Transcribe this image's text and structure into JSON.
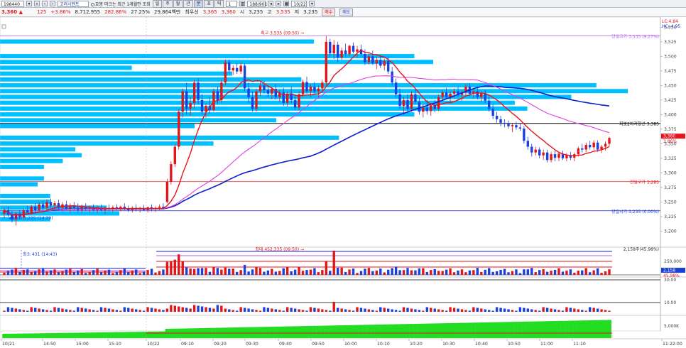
{
  "toolbar": {
    "code": "198440",
    "name": "고려시멘트",
    "radio_label": "호봉 마크는 최근 1개월만 조회",
    "period_buttons": [
      "일",
      "주",
      "월",
      "년",
      "분",
      "초",
      "틱"
    ],
    "interval_value": "1",
    "count": "188/901",
    "date": "10/22"
  },
  "quote": {
    "price": "3,360",
    "change": "125",
    "change_pct": "+3.86%",
    "volume": "8,712,955",
    "volume_ratio": "282.86%",
    "turnover_ratio": "27.25%",
    "amount": "29,864백만",
    "best_ask_label": "최우선",
    "best_ask": "3,365",
    "best_bid": "3,360",
    "open_label": "시",
    "open": "3,235",
    "high_label": "고",
    "high": "3,535",
    "low_label": "저",
    "low": "3,235",
    "buy_label": "매수",
    "sell_label": "매도"
  },
  "labels": {
    "lc": "LC:4.84",
    "hc": "HC:-4.95",
    "high_marker": "최고 3,535 (09:50)",
    "low_marker": "최저가 3,235 (14:39)",
    "day_high": "당일고가 3,535 (9.27%)",
    "support": "피봇2차저항선 3,385",
    "prev_high": "전일고가 3,285",
    "day_open": "당일시가 3,235 (0.00%)",
    "price_tag": "3,360",
    "pct_tag": "3.86%",
    "vol_max": "최대 452,335 (09:50)",
    "vol_min": "최소 431 (14:43)",
    "vol_pct": "2,158주(45.98%)",
    "vol_tag": "2,158",
    "vol_pct_tag": "45.98%"
  },
  "colors": {
    "up": "#e0161b",
    "down": "#1c3fe0",
    "ma_short": "#e8141c",
    "ma_mid": "#e040e0",
    "ma_long": "#0b1fd0",
    "profile": "#00bfff",
    "cum_volume": "#22dd22"
  },
  "chart_data": {
    "type": "candlestick",
    "ylim": [
      3175,
      3565
    ],
    "price_ticks": [
      "3,550",
      "3,525",
      "3,500",
      "3,475",
      "3,450",
      "3,425",
      "3,400",
      "3,375",
      "3,350",
      "3,325",
      "3,300",
      "3,275",
      "3,250",
      "3,225",
      "3,200"
    ],
    "time_ticks": [
      "10/21",
      "14:50",
      "15:00",
      "15:10",
      "10/22",
      "09:10",
      "09:20",
      "09:30",
      "09:40",
      "09:50",
      "10:00",
      "10:10",
      "10:20",
      "10:30",
      "10:40",
      "10:50",
      "11:00",
      "11:10",
      "11:22:00"
    ],
    "reference_lines": {
      "day_high": 3535,
      "support": 3385,
      "prev_high": 3285,
      "day_open": 3235
    },
    "volume_ticks": [
      "250,000",
      "0"
    ],
    "osc_ticks": [
      "30.00",
      "10.00"
    ],
    "cum_ticks": [
      "5,000K"
    ],
    "volume_profile": [
      {
        "price": 3525,
        "width": 0.5
      },
      {
        "price": 3500,
        "width": 0.66
      },
      {
        "price": 3490,
        "width": 0.69
      },
      {
        "price": 3480,
        "width": 0.21
      },
      {
        "price": 3470,
        "width": 0.37
      },
      {
        "price": 3460,
        "width": 0.48
      },
      {
        "price": 3450,
        "width": 0.95
      },
      {
        "price": 3440,
        "width": 1.0
      },
      {
        "price": 3430,
        "width": 0.91
      },
      {
        "price": 3420,
        "width": 0.82
      },
      {
        "price": 3410,
        "width": 0.84
      },
      {
        "price": 3400,
        "width": 0.66
      },
      {
        "price": 3390,
        "width": 0.44
      },
      {
        "price": 3380,
        "width": 0.31
      },
      {
        "price": 3360,
        "width": 0.54
      },
      {
        "price": 3350,
        "width": 0.34
      },
      {
        "price": 3340,
        "width": 0.12
      },
      {
        "price": 3330,
        "width": 0.13
      },
      {
        "price": 3320,
        "width": 0.1
      },
      {
        "price": 3310,
        "width": 0.07
      },
      {
        "price": 3290,
        "width": 0.07
      },
      {
        "price": 3280,
        "width": 0.06
      },
      {
        "price": 3260,
        "width": 0.08
      },
      {
        "price": 3250,
        "width": 0.08
      },
      {
        "price": 3240,
        "width": 0.17
      },
      {
        "price": 3230,
        "width": 0.19
      },
      {
        "price": 3220,
        "width": 0.08
      }
    ],
    "candles": [
      {
        "o": 3230,
        "h": 3240,
        "l": 3222,
        "c": 3236
      },
      {
        "o": 3236,
        "h": 3242,
        "l": 3225,
        "c": 3228
      },
      {
        "o": 3228,
        "h": 3235,
        "l": 3215,
        "c": 3220
      },
      {
        "o": 3220,
        "h": 3232,
        "l": 3210,
        "c": 3230
      },
      {
        "o": 3230,
        "h": 3236,
        "l": 3220,
        "c": 3224
      },
      {
        "o": 3224,
        "h": 3238,
        "l": 3220,
        "c": 3236
      },
      {
        "o": 3236,
        "h": 3244,
        "l": 3228,
        "c": 3232
      },
      {
        "o": 3232,
        "h": 3245,
        "l": 3228,
        "c": 3242
      },
      {
        "o": 3242,
        "h": 3248,
        "l": 3232,
        "c": 3236
      },
      {
        "o": 3236,
        "h": 3250,
        "l": 3232,
        "c": 3246
      },
      {
        "o": 3246,
        "h": 3252,
        "l": 3236,
        "c": 3240
      },
      {
        "o": 3240,
        "h": 3255,
        "l": 3236,
        "c": 3250
      },
      {
        "o": 3250,
        "h": 3256,
        "l": 3240,
        "c": 3244
      },
      {
        "o": 3244,
        "h": 3252,
        "l": 3238,
        "c": 3248
      },
      {
        "o": 3248,
        "h": 3254,
        "l": 3236,
        "c": 3240
      },
      {
        "o": 3240,
        "h": 3250,
        "l": 3234,
        "c": 3246
      },
      {
        "o": 3246,
        "h": 3252,
        "l": 3236,
        "c": 3238
      },
      {
        "o": 3238,
        "h": 3248,
        "l": 3232,
        "c": 3244
      },
      {
        "o": 3244,
        "h": 3250,
        "l": 3236,
        "c": 3240
      },
      {
        "o": 3240,
        "h": 3248,
        "l": 3232,
        "c": 3236
      },
      {
        "o": 3236,
        "h": 3246,
        "l": 3232,
        "c": 3242
      },
      {
        "o": 3242,
        "h": 3248,
        "l": 3235,
        "c": 3238
      },
      {
        "o": 3238,
        "h": 3244,
        "l": 3232,
        "c": 3240
      },
      {
        "o": 3240,
        "h": 3246,
        "l": 3234,
        "c": 3236
      },
      {
        "o": 3236,
        "h": 3244,
        "l": 3232,
        "c": 3240
      },
      {
        "o": 3240,
        "h": 3246,
        "l": 3234,
        "c": 3236
      },
      {
        "o": 3236,
        "h": 3242,
        "l": 3230,
        "c": 3240
      },
      {
        "o": 3240,
        "h": 3246,
        "l": 3234,
        "c": 3238
      },
      {
        "o": 3238,
        "h": 3244,
        "l": 3233,
        "c": 3241
      },
      {
        "o": 3241,
        "h": 3246,
        "l": 3236,
        "c": 3238
      },
      {
        "o": 3238,
        "h": 3244,
        "l": 3234,
        "c": 3242
      },
      {
        "o": 3242,
        "h": 3248,
        "l": 3236,
        "c": 3239
      },
      {
        "o": 3239,
        "h": 3244,
        "l": 3233,
        "c": 3236
      },
      {
        "o": 3236,
        "h": 3243,
        "l": 3232,
        "c": 3240
      },
      {
        "o": 3240,
        "h": 3246,
        "l": 3234,
        "c": 3237
      },
      {
        "o": 3237,
        "h": 3242,
        "l": 3232,
        "c": 3240
      },
      {
        "o": 3240,
        "h": 3245,
        "l": 3235,
        "c": 3236
      },
      {
        "o": 3236,
        "h": 3242,
        "l": 3232,
        "c": 3241
      },
      {
        "o": 3241,
        "h": 3246,
        "l": 3234,
        "c": 3238
      },
      {
        "o": 3238,
        "h": 3243,
        "l": 3233,
        "c": 3240
      },
      {
        "o": 3240,
        "h": 3246,
        "l": 3236,
        "c": 3242
      },
      {
        "o": 3242,
        "h": 3248,
        "l": 3237,
        "c": 3239
      },
      {
        "o": 3250,
        "h": 3290,
        "l": 3248,
        "c": 3285
      },
      {
        "o": 3285,
        "h": 3320,
        "l": 3280,
        "c": 3315
      },
      {
        "o": 3315,
        "h": 3350,
        "l": 3310,
        "c": 3345
      },
      {
        "o": 3345,
        "h": 3410,
        "l": 3340,
        "c": 3405
      },
      {
        "o": 3405,
        "h": 3445,
        "l": 3395,
        "c": 3440
      },
      {
        "o": 3440,
        "h": 3455,
        "l": 3400,
        "c": 3410
      },
      {
        "o": 3410,
        "h": 3430,
        "l": 3398,
        "c": 3420
      },
      {
        "o": 3420,
        "h": 3460,
        "l": 3410,
        "c": 3455
      },
      {
        "o": 3455,
        "h": 3462,
        "l": 3418,
        "c": 3425
      },
      {
        "o": 3425,
        "h": 3435,
        "l": 3400,
        "c": 3405
      },
      {
        "o": 3405,
        "h": 3420,
        "l": 3395,
        "c": 3415
      },
      {
        "o": 3415,
        "h": 3430,
        "l": 3402,
        "c": 3408
      },
      {
        "o": 3408,
        "h": 3445,
        "l": 3405,
        "c": 3440
      },
      {
        "o": 3440,
        "h": 3448,
        "l": 3418,
        "c": 3425
      },
      {
        "o": 3425,
        "h": 3460,
        "l": 3420,
        "c": 3455
      },
      {
        "o": 3455,
        "h": 3495,
        "l": 3450,
        "c": 3490
      },
      {
        "o": 3490,
        "h": 3495,
        "l": 3470,
        "c": 3476
      },
      {
        "o": 3476,
        "h": 3485,
        "l": 3468,
        "c": 3480
      },
      {
        "o": 3480,
        "h": 3488,
        "l": 3470,
        "c": 3474
      },
      {
        "o": 3474,
        "h": 3490,
        "l": 3470,
        "c": 3484
      },
      {
        "o": 3484,
        "h": 3488,
        "l": 3440,
        "c": 3445
      },
      {
        "o": 3445,
        "h": 3455,
        "l": 3420,
        "c": 3430
      },
      {
        "o": 3430,
        "h": 3440,
        "l": 3405,
        "c": 3410
      },
      {
        "o": 3410,
        "h": 3445,
        "l": 3405,
        "c": 3440
      },
      {
        "o": 3440,
        "h": 3456,
        "l": 3432,
        "c": 3450
      },
      {
        "o": 3450,
        "h": 3458,
        "l": 3436,
        "c": 3442
      },
      {
        "o": 3442,
        "h": 3450,
        "l": 3430,
        "c": 3436
      },
      {
        "o": 3436,
        "h": 3448,
        "l": 3426,
        "c": 3444
      },
      {
        "o": 3444,
        "h": 3452,
        "l": 3426,
        "c": 3430
      },
      {
        "o": 3430,
        "h": 3442,
        "l": 3422,
        "c": 3438
      },
      {
        "o": 3438,
        "h": 3446,
        "l": 3415,
        "c": 3420
      },
      {
        "o": 3420,
        "h": 3440,
        "l": 3414,
        "c": 3436
      },
      {
        "o": 3436,
        "h": 3448,
        "l": 3420,
        "c": 3425
      },
      {
        "o": 3425,
        "h": 3435,
        "l": 3408,
        "c": 3412
      },
      {
        "o": 3412,
        "h": 3440,
        "l": 3408,
        "c": 3435
      },
      {
        "o": 3435,
        "h": 3460,
        "l": 3430,
        "c": 3456
      },
      {
        "o": 3456,
        "h": 3465,
        "l": 3436,
        "c": 3440
      },
      {
        "o": 3440,
        "h": 3452,
        "l": 3430,
        "c": 3448
      },
      {
        "o": 3448,
        "h": 3456,
        "l": 3435,
        "c": 3440
      },
      {
        "o": 3440,
        "h": 3450,
        "l": 3428,
        "c": 3445
      },
      {
        "o": 3445,
        "h": 3460,
        "l": 3440,
        "c": 3455
      },
      {
        "o": 3455,
        "h": 3535,
        "l": 3450,
        "c": 3525
      },
      {
        "o": 3525,
        "h": 3530,
        "l": 3500,
        "c": 3505
      },
      {
        "o": 3505,
        "h": 3528,
        "l": 3495,
        "c": 3520
      },
      {
        "o": 3520,
        "h": 3525,
        "l": 3490,
        "c": 3498
      },
      {
        "o": 3498,
        "h": 3515,
        "l": 3494,
        "c": 3510
      },
      {
        "o": 3510,
        "h": 3522,
        "l": 3500,
        "c": 3504
      },
      {
        "o": 3504,
        "h": 3520,
        "l": 3500,
        "c": 3518
      },
      {
        "o": 3518,
        "h": 3524,
        "l": 3505,
        "c": 3508
      },
      {
        "o": 3508,
        "h": 3518,
        "l": 3498,
        "c": 3512
      },
      {
        "o": 3512,
        "h": 3520,
        "l": 3500,
        "c": 3504
      },
      {
        "o": 3504,
        "h": 3512,
        "l": 3485,
        "c": 3490
      },
      {
        "o": 3490,
        "h": 3505,
        "l": 3486,
        "c": 3500
      },
      {
        "o": 3500,
        "h": 3510,
        "l": 3485,
        "c": 3488
      },
      {
        "o": 3488,
        "h": 3500,
        "l": 3478,
        "c": 3494
      },
      {
        "o": 3494,
        "h": 3502,
        "l": 3480,
        "c": 3484
      },
      {
        "o": 3484,
        "h": 3496,
        "l": 3476,
        "c": 3492
      },
      {
        "o": 3492,
        "h": 3500,
        "l": 3470,
        "c": 3474
      },
      {
        "o": 3474,
        "h": 3482,
        "l": 3450,
        "c": 3455
      },
      {
        "o": 3455,
        "h": 3462,
        "l": 3430,
        "c": 3435
      },
      {
        "o": 3435,
        "h": 3445,
        "l": 3410,
        "c": 3415
      },
      {
        "o": 3415,
        "h": 3430,
        "l": 3400,
        "c": 3425
      },
      {
        "o": 3425,
        "h": 3435,
        "l": 3405,
        "c": 3410
      },
      {
        "o": 3410,
        "h": 3440,
        "l": 3405,
        "c": 3435
      },
      {
        "o": 3435,
        "h": 3445,
        "l": 3418,
        "c": 3422
      },
      {
        "o": 3422,
        "h": 3430,
        "l": 3400,
        "c": 3405
      },
      {
        "o": 3405,
        "h": 3418,
        "l": 3395,
        "c": 3412
      },
      {
        "o": 3412,
        "h": 3425,
        "l": 3400,
        "c": 3406
      },
      {
        "o": 3406,
        "h": 3420,
        "l": 3398,
        "c": 3416
      },
      {
        "o": 3416,
        "h": 3425,
        "l": 3404,
        "c": 3410
      },
      {
        "o": 3410,
        "h": 3435,
        "l": 3406,
        "c": 3430
      },
      {
        "o": 3430,
        "h": 3442,
        "l": 3424,
        "c": 3438
      },
      {
        "o": 3438,
        "h": 3446,
        "l": 3426,
        "c": 3430
      },
      {
        "o": 3430,
        "h": 3440,
        "l": 3420,
        "c": 3436
      },
      {
        "o": 3436,
        "h": 3445,
        "l": 3428,
        "c": 3440
      },
      {
        "o": 3440,
        "h": 3448,
        "l": 3430,
        "c": 3434
      },
      {
        "o": 3434,
        "h": 3442,
        "l": 3424,
        "c": 3438
      },
      {
        "o": 3438,
        "h": 3452,
        "l": 3434,
        "c": 3448
      },
      {
        "o": 3448,
        "h": 3454,
        "l": 3432,
        "c": 3436
      },
      {
        "o": 3436,
        "h": 3444,
        "l": 3428,
        "c": 3440
      },
      {
        "o": 3440,
        "h": 3446,
        "l": 3426,
        "c": 3430
      },
      {
        "o": 3430,
        "h": 3440,
        "l": 3422,
        "c": 3436
      },
      {
        "o": 3436,
        "h": 3442,
        "l": 3420,
        "c": 3424
      },
      {
        "o": 3424,
        "h": 3430,
        "l": 3405,
        "c": 3410
      },
      {
        "o": 3410,
        "h": 3418,
        "l": 3392,
        "c": 3398
      },
      {
        "o": 3398,
        "h": 3405,
        "l": 3386,
        "c": 3392
      },
      {
        "o": 3392,
        "h": 3398,
        "l": 3380,
        "c": 3386
      },
      {
        "o": 3386,
        "h": 3392,
        "l": 3378,
        "c": 3384
      },
      {
        "o": 3384,
        "h": 3390,
        "l": 3376,
        "c": 3380
      },
      {
        "o": 3380,
        "h": 3386,
        "l": 3370,
        "c": 3382
      },
      {
        "o": 3382,
        "h": 3388,
        "l": 3374,
        "c": 3378
      },
      {
        "o": 3378,
        "h": 3384,
        "l": 3372,
        "c": 3376
      },
      {
        "o": 3376,
        "h": 3380,
        "l": 3350,
        "c": 3355
      },
      {
        "o": 3355,
        "h": 3362,
        "l": 3340,
        "c": 3345
      },
      {
        "o": 3345,
        "h": 3350,
        "l": 3328,
        "c": 3335
      },
      {
        "o": 3335,
        "h": 3345,
        "l": 3330,
        "c": 3340
      },
      {
        "o": 3340,
        "h": 3344,
        "l": 3325,
        "c": 3330
      },
      {
        "o": 3330,
        "h": 3340,
        "l": 3322,
        "c": 3335
      },
      {
        "o": 3335,
        "h": 3340,
        "l": 3318,
        "c": 3322
      },
      {
        "o": 3322,
        "h": 3336,
        "l": 3318,
        "c": 3332
      },
      {
        "o": 3332,
        "h": 3338,
        "l": 3320,
        "c": 3326
      },
      {
        "o": 3326,
        "h": 3336,
        "l": 3320,
        "c": 3333
      },
      {
        "o": 3333,
        "h": 3338,
        "l": 3322,
        "c": 3325
      },
      {
        "o": 3325,
        "h": 3334,
        "l": 3320,
        "c": 3330
      },
      {
        "o": 3330,
        "h": 3336,
        "l": 3322,
        "c": 3326
      },
      {
        "o": 3326,
        "h": 3335,
        "l": 3320,
        "c": 3332
      },
      {
        "o": 3332,
        "h": 3345,
        "l": 3328,
        "c": 3342
      },
      {
        "o": 3342,
        "h": 3350,
        "l": 3335,
        "c": 3340
      },
      {
        "o": 3340,
        "h": 3352,
        "l": 3336,
        "c": 3348
      },
      {
        "o": 3348,
        "h": 3355,
        "l": 3340,
        "c": 3344
      },
      {
        "o": 3344,
        "h": 3356,
        "l": 3340,
        "c": 3352
      },
      {
        "o": 3352,
        "h": 3356,
        "l": 3336,
        "c": 3340
      },
      {
        "o": 3340,
        "h": 3348,
        "l": 3334,
        "c": 3345
      },
      {
        "o": 3345,
        "h": 3354,
        "l": 3338,
        "c": 3350
      },
      {
        "o": 3350,
        "h": 3362,
        "l": 3346,
        "c": 3360
      }
    ]
  }
}
